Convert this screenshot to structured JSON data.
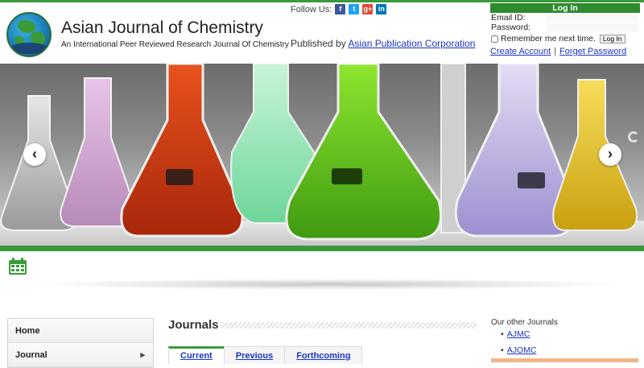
{
  "header": {
    "title": "Asian Journal of Chemistry",
    "subtitle": "An International Peer Reviewed Research Journal Of Chemistry",
    "follow_label": "Follow Us:",
    "social": [
      {
        "name": "facebook-icon",
        "glyph": "f"
      },
      {
        "name": "twitter-icon",
        "glyph": "t"
      },
      {
        "name": "google-plus-icon",
        "glyph": "g+"
      },
      {
        "name": "linkedin-icon",
        "glyph": "in"
      }
    ],
    "published_prefix": "Published by",
    "publisher": "Asian Publication Corporation"
  },
  "login": {
    "heading": "Log In",
    "email_label": "Email ID:",
    "email_value": "",
    "password_label": "Password:",
    "password_value": "",
    "remember_label": "Remember me next time.",
    "button": "Log In",
    "create_account": "Create Account",
    "separator": "|",
    "forget_password": "Forget Password"
  },
  "slider": {
    "prev_label": "‹",
    "next_label": "›"
  },
  "leftnav": {
    "items": [
      {
        "label": "Home",
        "has_submenu": false
      },
      {
        "label": "Journal",
        "has_submenu": true,
        "chevron": "▸"
      }
    ]
  },
  "main": {
    "title": "Journals",
    "tabs": [
      {
        "label": "Current",
        "active": true
      },
      {
        "label": "Previous",
        "active": false
      },
      {
        "label": "Forthcoming",
        "active": false
      }
    ]
  },
  "sidebar_right": {
    "title": "Our other Journals",
    "links": [
      "AJMC",
      "AJOMC"
    ]
  },
  "colors": {
    "brand_green": "#3a9a3c",
    "link_blue": "#1a35c4",
    "login_header": "#2e8b2e",
    "accent_orange": "#f0b58a"
  }
}
